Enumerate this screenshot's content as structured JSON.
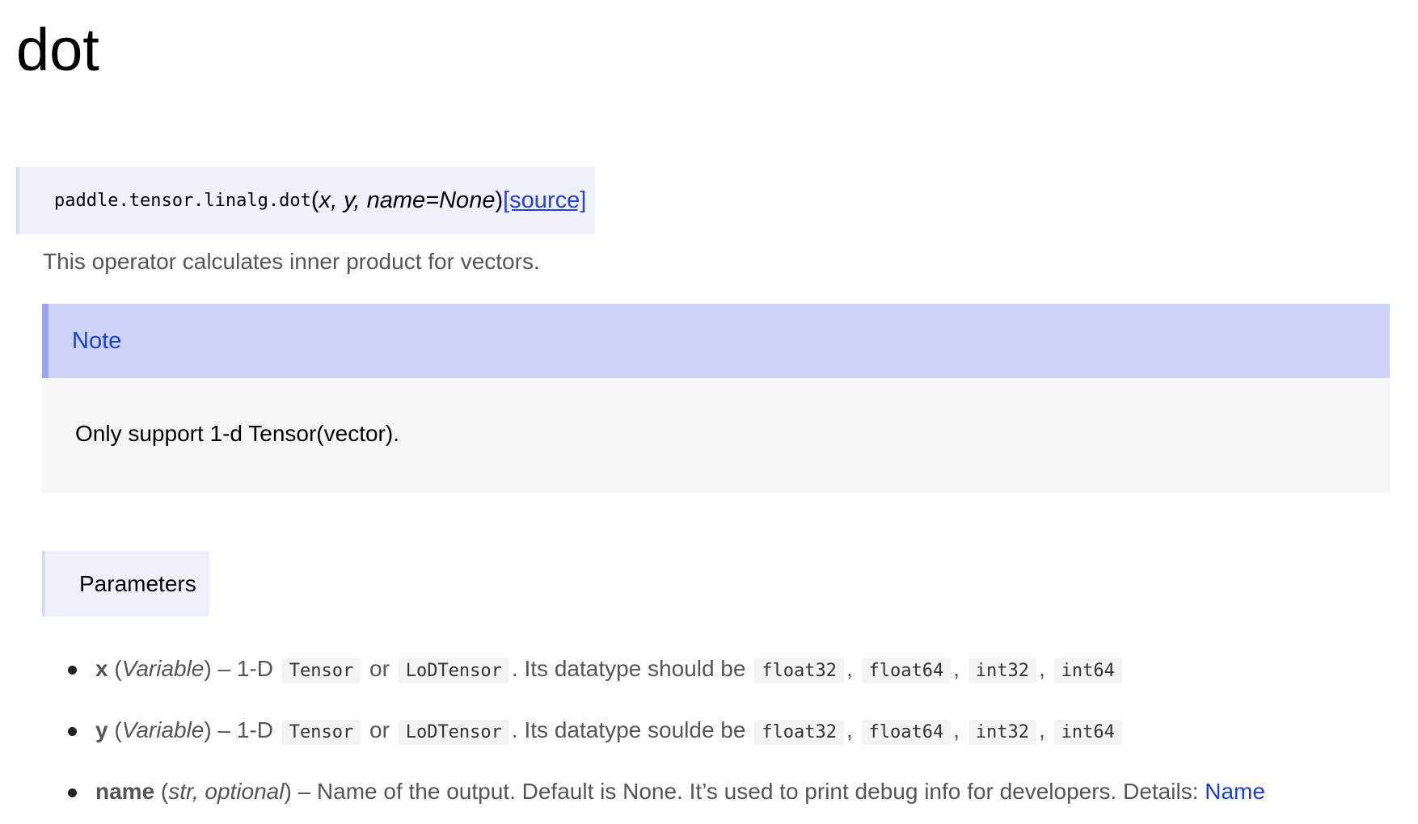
{
  "page": {
    "title": "dot"
  },
  "signature": {
    "path": "paddle.tensor.linalg.dot",
    "open_paren": "(",
    "args": "x, y, name=None",
    "close_paren": ")",
    "source_link": "[source]"
  },
  "description": "This operator calculates inner product for vectors.",
  "note": {
    "title": "Note",
    "body": "Only support 1-d Tensor(vector)."
  },
  "parameters": {
    "header": "Parameters",
    "items": [
      {
        "name": "x",
        "type": "Variable",
        "sep": " – 1-D ",
        "code1": "Tensor",
        "or": " or ",
        "code2": "LoDTensor",
        "desc": ". Its datatype should be ",
        "dtypes": [
          "float32",
          "float64",
          "int32",
          "int64"
        ]
      },
      {
        "name": "y",
        "type": "Variable",
        "sep": " – 1-D ",
        "code1": "Tensor",
        "or": " or ",
        "code2": "LoDTensor",
        "desc": ". Its datatype soulde be ",
        "dtypes": [
          "float32",
          "float64",
          "int32",
          "int64"
        ]
      },
      {
        "name": "name",
        "type": "str,  optional",
        "desc": " – Name of the output. Default is None. It’s used to print debug info for developers. Details: ",
        "link": "Name"
      }
    ]
  },
  "colors": {
    "link": "#2a3fd4",
    "note_header_bg": "#cdd3f7",
    "note_header_border": "#9aa7ef",
    "note_body_bg": "#f6f6f6",
    "signature_bg": "#eef0fb",
    "body_text": "#555555"
  }
}
